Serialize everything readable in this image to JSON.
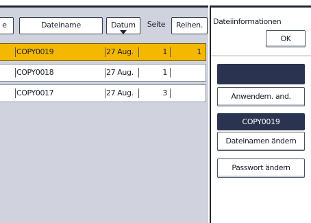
{
  "file_list": {
    "columns": {
      "partial": "e",
      "name": "Dateiname",
      "date": "Datum",
      "pages": "Seite",
      "order": "Reihen."
    },
    "rows": [
      {
        "name": "COPY0019",
        "date": "27 Aug.",
        "pages": "1",
        "order": "1",
        "selected": true
      },
      {
        "name": "COPY0018",
        "date": "27 Aug.",
        "pages": "1",
        "order": "",
        "selected": false
      },
      {
        "name": "COPY0017",
        "date": "27 Aug.",
        "pages": "3",
        "order": "",
        "selected": false
      }
    ]
  },
  "info_panel": {
    "title": "Dateiinformationen",
    "ok_label": "OK",
    "apply_label": "Anwendem. and.",
    "file_name": "COPY0019",
    "rename_label": "Dateinamen ändern",
    "password_label": "Passwort ändern"
  },
  "colors": {
    "selected_row": "#f5b800",
    "dark_accent": "#2a3350",
    "panel_bg": "#d0d3dd"
  }
}
